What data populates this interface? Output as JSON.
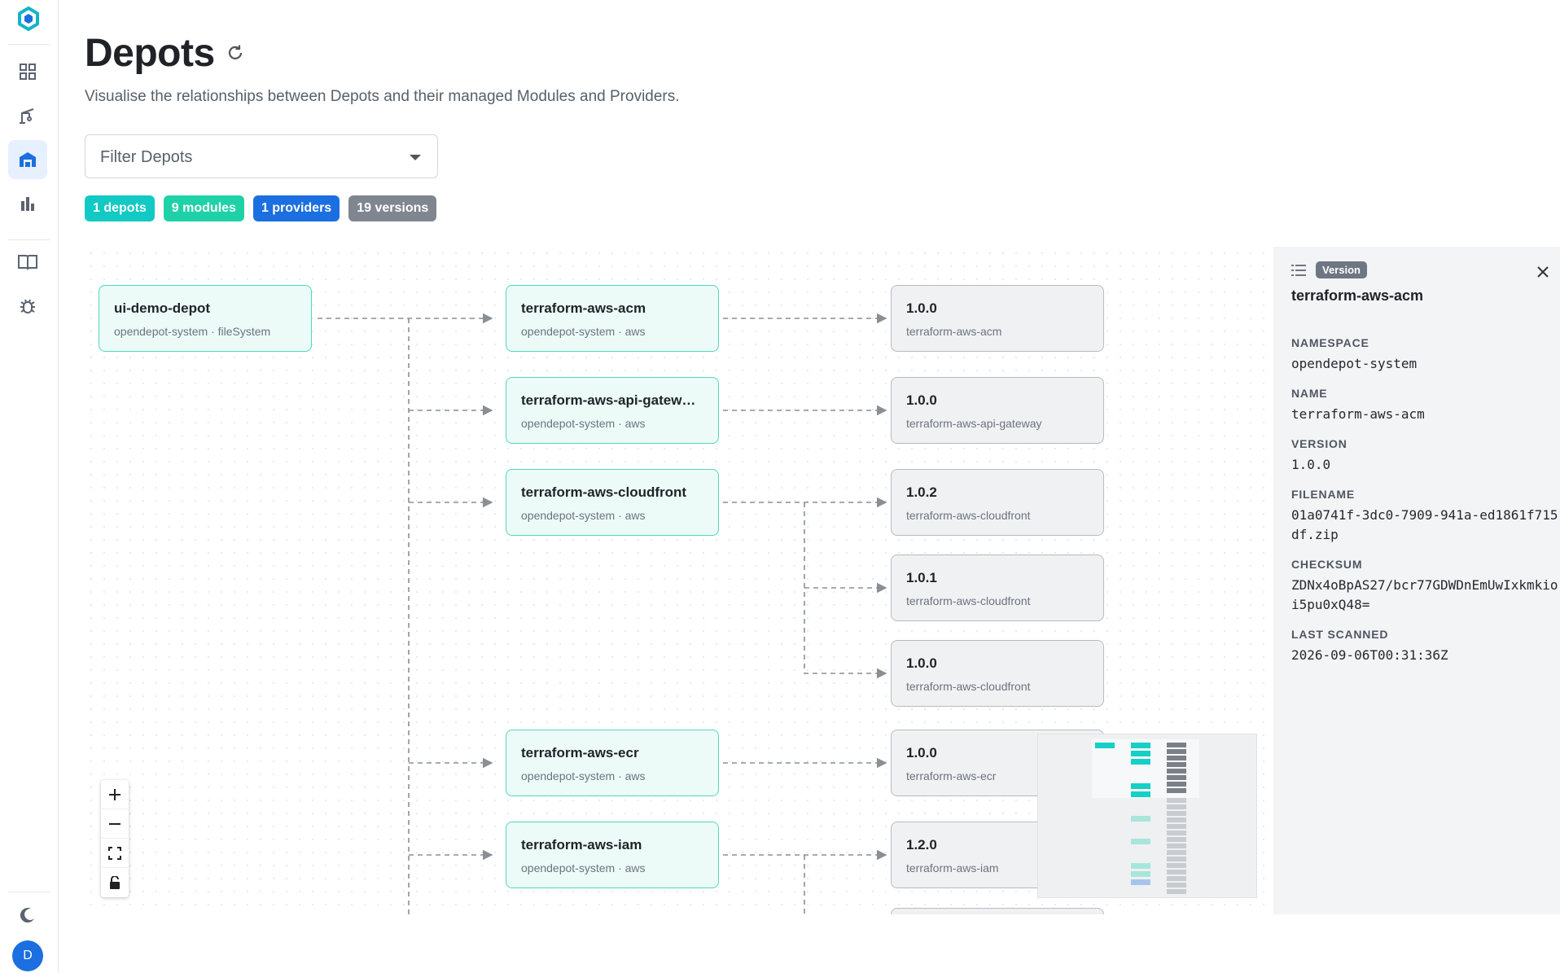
{
  "page": {
    "title": "Depots",
    "subtitle": "Visualise the relationships between Depots and their managed Modules and Providers.",
    "filter_placeholder": "Filter Depots"
  },
  "badges": [
    {
      "label": "1 depots",
      "color": "#12c9c4"
    },
    {
      "label": "9 modules",
      "color": "#1fd1a7"
    },
    {
      "label": "1 providers",
      "color": "#1b6fe0"
    },
    {
      "label": "19 versions",
      "color": "#80868f"
    }
  ],
  "sidebar": {
    "items": [
      {
        "icon": "grid-icon"
      },
      {
        "icon": "crane-icon"
      },
      {
        "icon": "warehouse-icon",
        "active": true
      },
      {
        "icon": "bar-chart-icon"
      },
      {
        "icon": "book-icon"
      },
      {
        "icon": "bug-icon"
      }
    ],
    "theme_icon": "moon-icon",
    "avatar_initial": "D"
  },
  "graph": {
    "depot": {
      "title": "ui-demo-depot",
      "sub": "opendepot-system · fileSystem"
    },
    "modules": [
      {
        "title": "terraform-aws-acm",
        "sub": "opendepot-system · aws"
      },
      {
        "title": "terraform-aws-api-gatew…",
        "sub": "opendepot-system · aws"
      },
      {
        "title": "terraform-aws-cloudfront",
        "sub": "opendepot-system · aws"
      },
      {
        "title": "terraform-aws-ecr",
        "sub": "opendepot-system · aws"
      },
      {
        "title": "terraform-aws-iam",
        "sub": "opendepot-system · aws"
      }
    ],
    "versions": [
      {
        "title": "1.0.0",
        "sub": "terraform-aws-acm"
      },
      {
        "title": "1.0.0",
        "sub": "terraform-aws-api-gateway"
      },
      {
        "title": "1.0.2",
        "sub": "terraform-aws-cloudfront"
      },
      {
        "title": "1.0.1",
        "sub": "terraform-aws-cloudfront"
      },
      {
        "title": "1.0.0",
        "sub": "terraform-aws-cloudfront"
      },
      {
        "title": "1.0.0",
        "sub": "terraform-aws-ecr"
      },
      {
        "title": "1.2.0",
        "sub": "terraform-aws-iam"
      }
    ]
  },
  "panel": {
    "badge": "Version",
    "title": "terraform-aws-acm",
    "fields": [
      {
        "label": "NAMESPACE",
        "value": "opendepot-system"
      },
      {
        "label": "NAME",
        "value": "terraform-aws-acm"
      },
      {
        "label": "VERSION",
        "value": "1.0.0"
      },
      {
        "label": "FILENAME",
        "value": "01a0741f-3dc0-7909-941a-ed1861f715df.zip"
      },
      {
        "label": "CHECKSUM",
        "value": "ZDNx4oBpAS27/bcr77GDWDnEmUwIxkmkioi5pu0xQ48="
      },
      {
        "label": "LAST SCANNED",
        "value": "2026-09-06T00:31:36Z"
      }
    ]
  }
}
